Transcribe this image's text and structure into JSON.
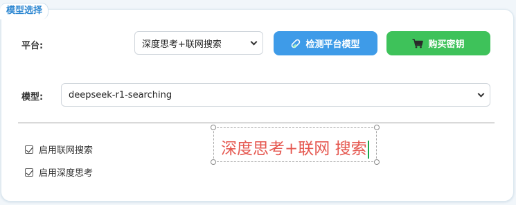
{
  "legend": "模型选择",
  "platform": {
    "label": "平台:",
    "selected": "深度思考+联网搜索"
  },
  "buttons": {
    "detect": "检测平台模型",
    "buy": "购买密钥"
  },
  "model": {
    "label": "模型:",
    "selected": "deepseek-r1-searching"
  },
  "options": {
    "web_search": "启用联网搜索",
    "deep_think": "启用深度思考"
  },
  "editor": {
    "text": "深度思考+联网 搜索"
  },
  "colors": {
    "accent_blue": "#3e9be8",
    "accent_green": "#3ec25a",
    "editor_text": "#e5574f",
    "caret": "#19a84c",
    "legend_text": "#2b86d1"
  },
  "icons": {
    "detect": "test-tube-icon",
    "buy": "shopping-cart-icon"
  }
}
